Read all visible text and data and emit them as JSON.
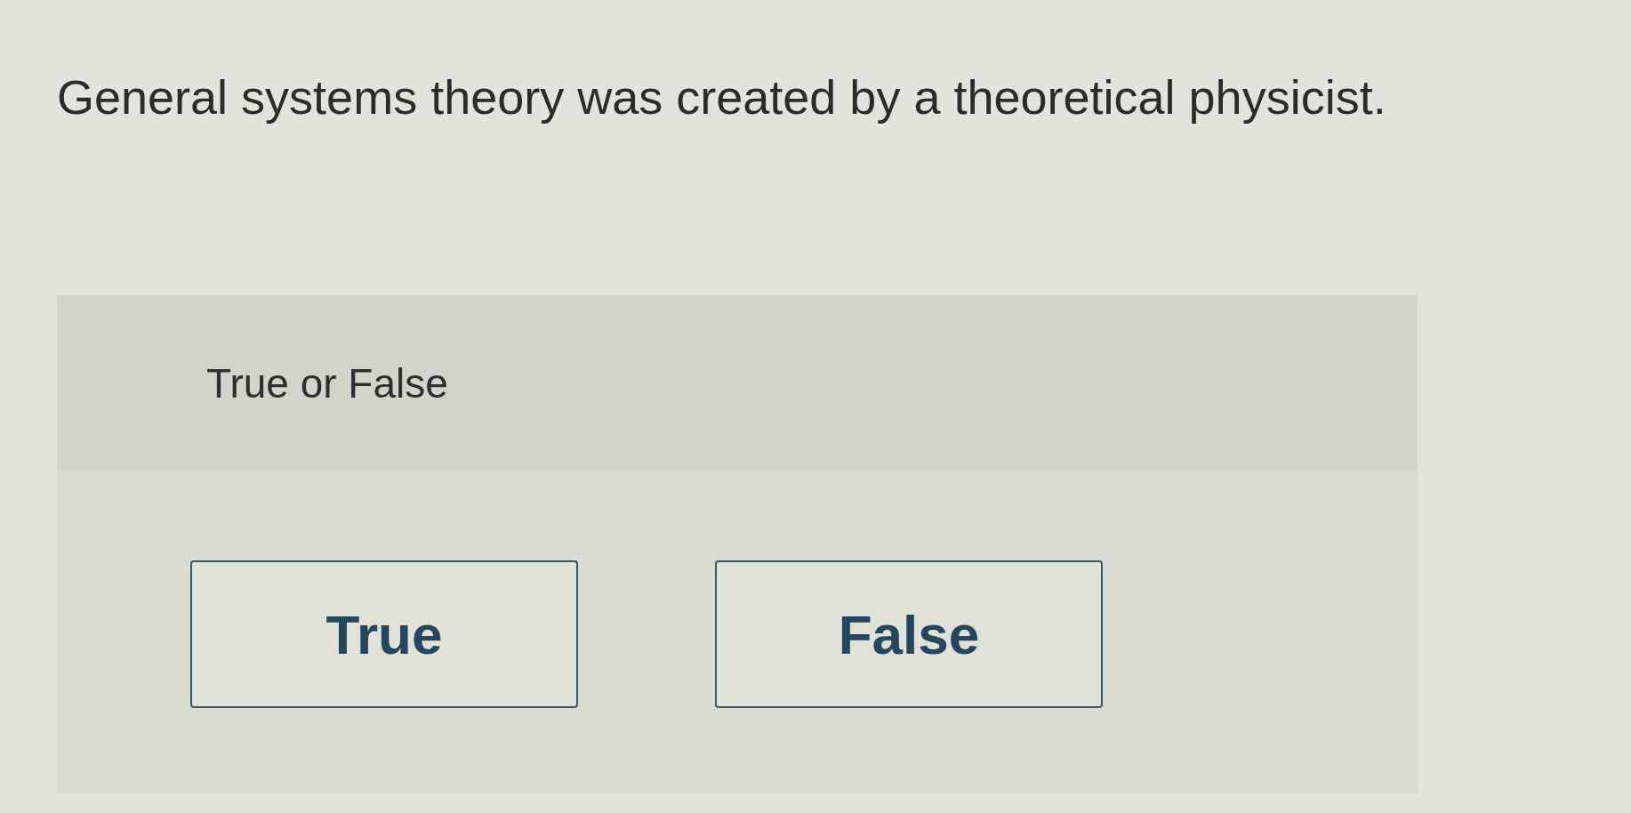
{
  "question": {
    "text": "General systems theory was created by a theoretical physicist."
  },
  "prompt": {
    "text": "True or False"
  },
  "options": [
    {
      "label": "True"
    },
    {
      "label": "False"
    }
  ]
}
